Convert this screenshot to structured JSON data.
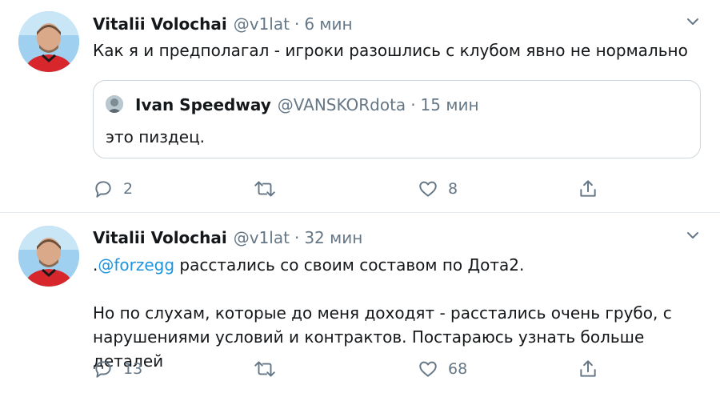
{
  "tweets": [
    {
      "author": {
        "name": "Vitalii Volochai",
        "handle": "@v1lat"
      },
      "separator": "·",
      "time": "6 мин",
      "text": "Как я и предполагал - игроки разошлись с клубом явно не нормально",
      "quoted": {
        "author": {
          "name": "Ivan Speedway",
          "handle": "@VANSKORdota"
        },
        "separator": "·",
        "time": "15 мин",
        "text": "это пиздец."
      },
      "stats": {
        "replies": "2",
        "retweets": "",
        "likes": "8"
      }
    },
    {
      "author": {
        "name": "Vitalii Volochai",
        "handle": "@v1lat"
      },
      "separator": "·",
      "time": "32 мин",
      "text_prefix": ".",
      "mention": "@forzegg",
      "text_rest": " расстались со своим составом по Дота2.",
      "text_para2": "Но по слухам, которые до меня доходят - расстались очень грубо, с нарушениями условий и контрактов. Постараюсь узнать больше деталей",
      "stats": {
        "replies": "13",
        "retweets": "",
        "likes": "68"
      }
    }
  ],
  "colors": {
    "text": "#14171a",
    "muted": "#657786",
    "link": "#1b95e0",
    "border": "#e6ecf0",
    "quote_border": "#ccd6dd"
  },
  "icons": {
    "reply": "speech-bubble-icon",
    "retweet": "retweet-arrows-icon",
    "like": "heart-outline-icon",
    "share": "share-upload-icon",
    "menu": "chevron-down-icon"
  }
}
